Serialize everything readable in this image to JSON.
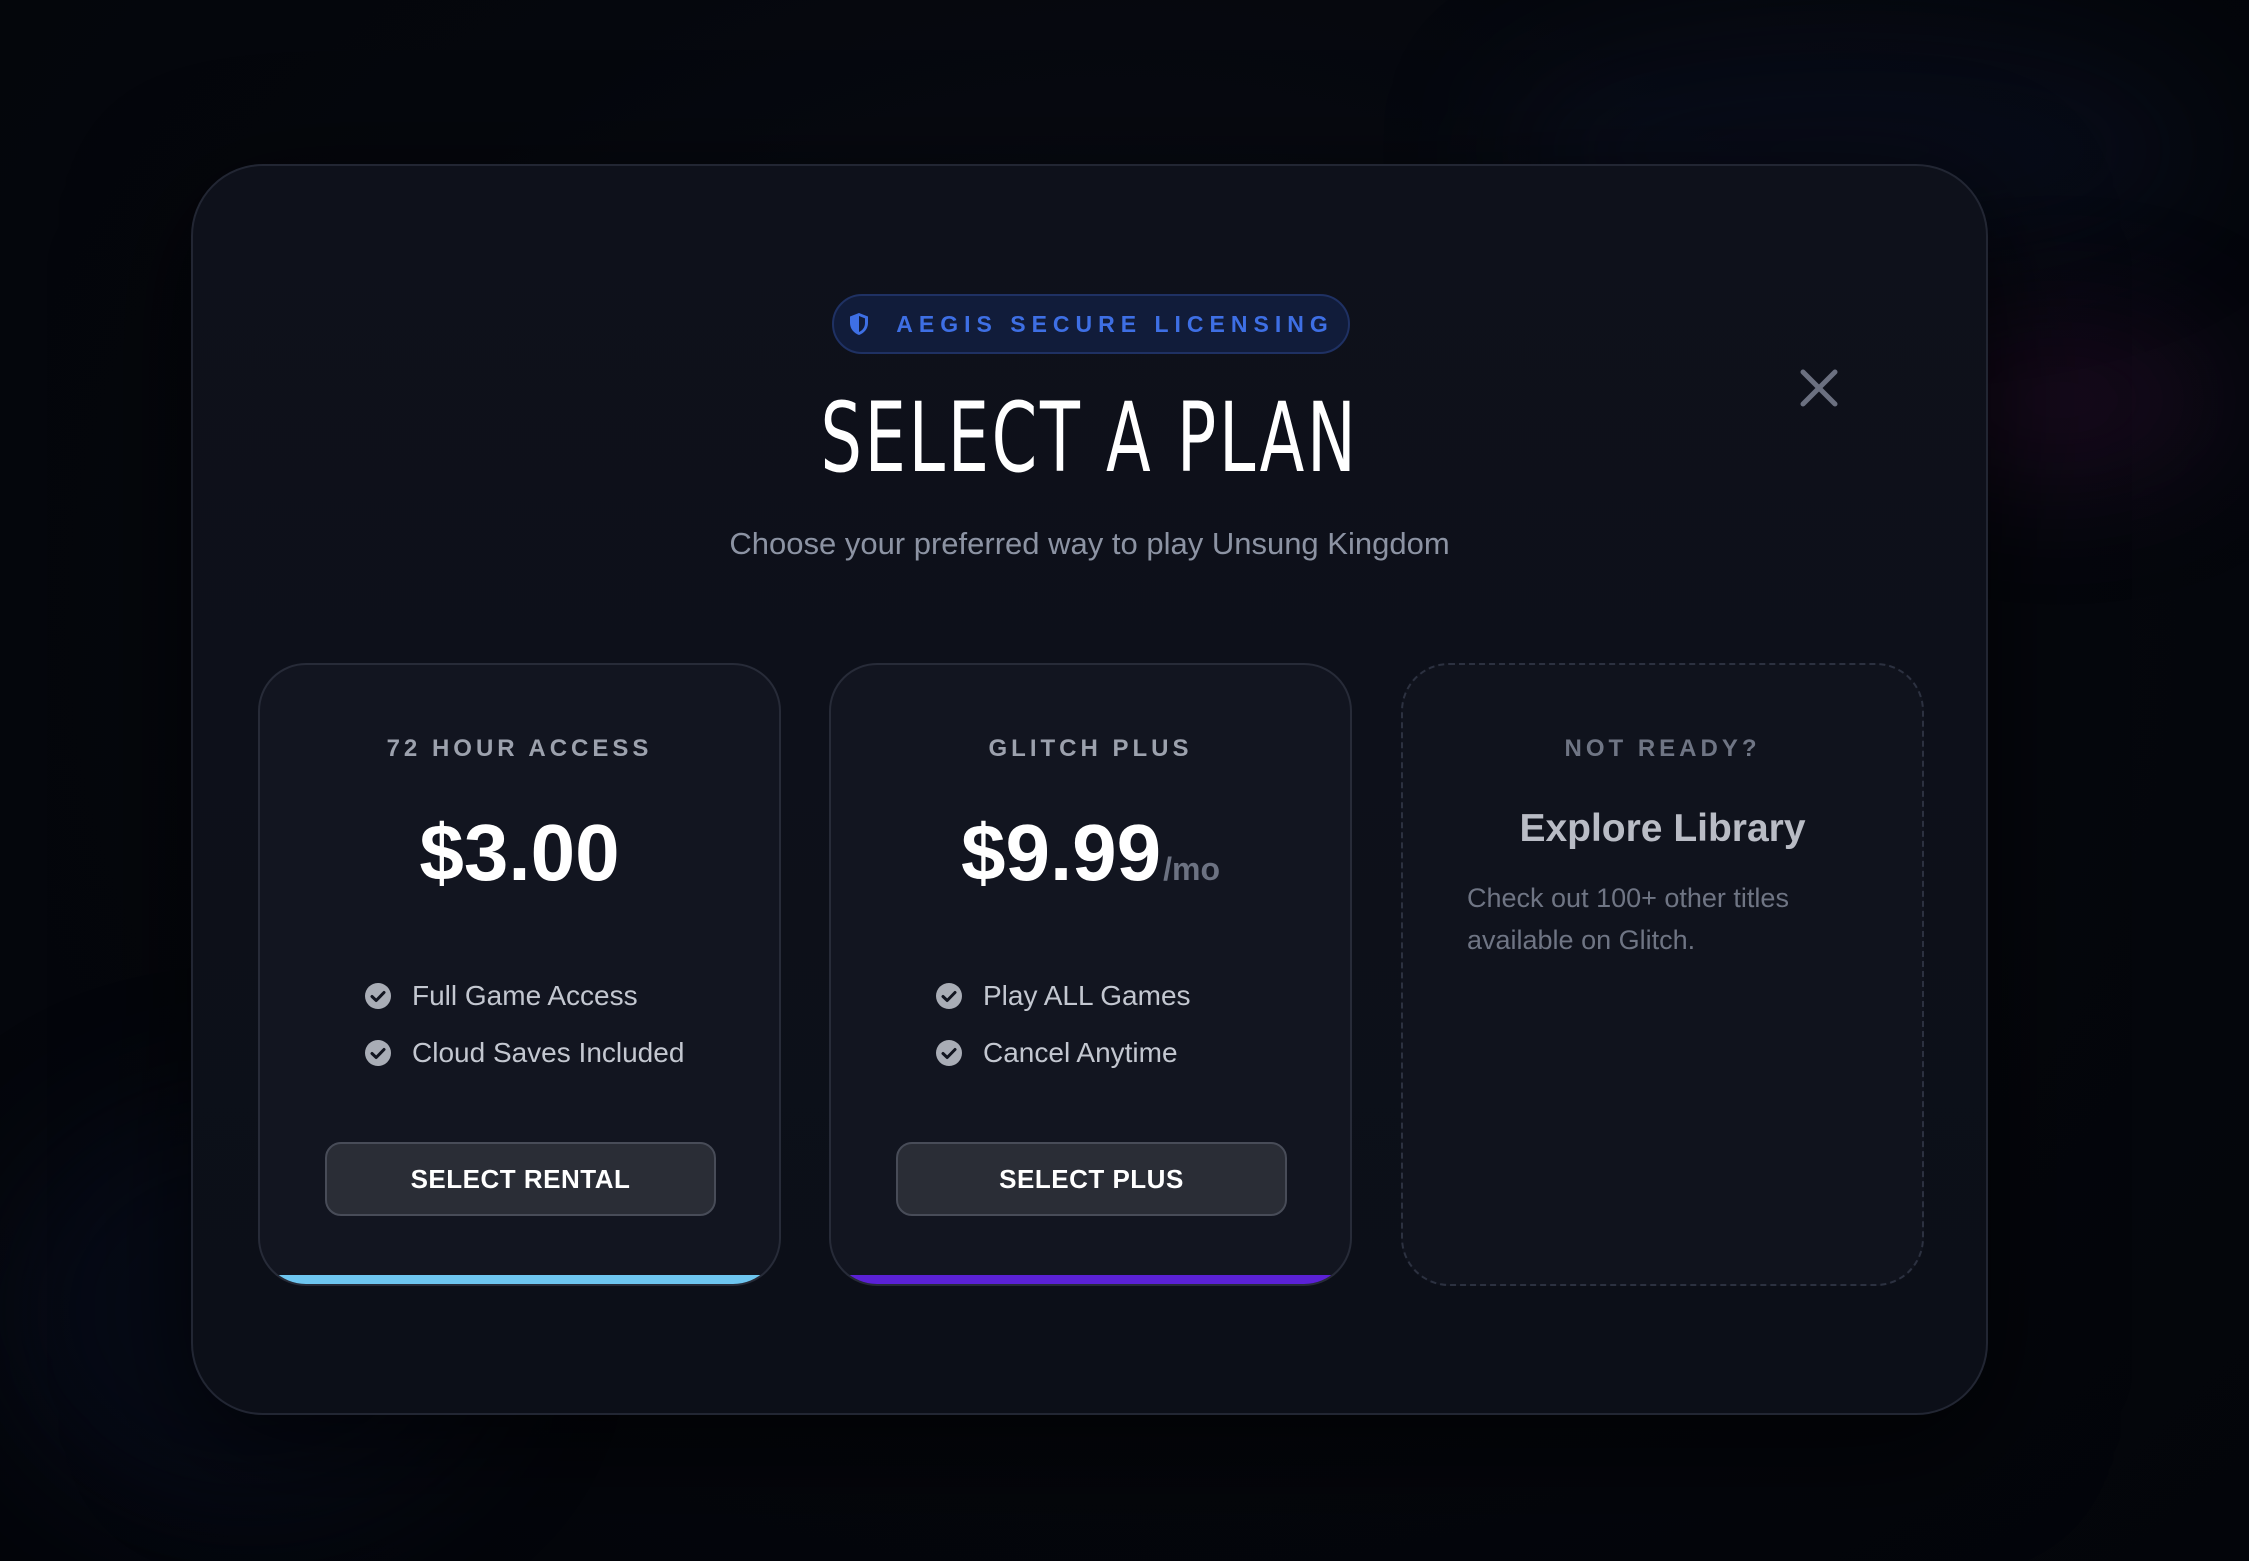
{
  "colors": {
    "badge_accent": "#3e6fe4",
    "rental_accent": "#6ec6f0",
    "plus_accent": "#5b21d6",
    "modal_background": "#0e111b"
  },
  "modal": {
    "badge": {
      "icon": "shield-icon",
      "label": "AEGIS SECURE LICENSING"
    },
    "close_icon": "close-icon",
    "title": "SELECT A PLAN",
    "subtitle": "Choose your preferred way to play Unsung Kingdom"
  },
  "plans": {
    "rental": {
      "label": "72 HOUR ACCESS",
      "price": "$3.00",
      "features": [
        "Full Game Access",
        "Cloud Saves Included"
      ],
      "button_label": "SELECT RENTAL"
    },
    "plus": {
      "label": "GLITCH PLUS",
      "price": "$9.99",
      "period": "/mo",
      "features": [
        "Play ALL Games",
        "Cancel Anytime"
      ],
      "button_label": "SELECT PLUS"
    },
    "explore": {
      "label": "NOT READY?",
      "title": "Explore Library",
      "description": "Check out 100+ other titles available on Glitch."
    }
  }
}
